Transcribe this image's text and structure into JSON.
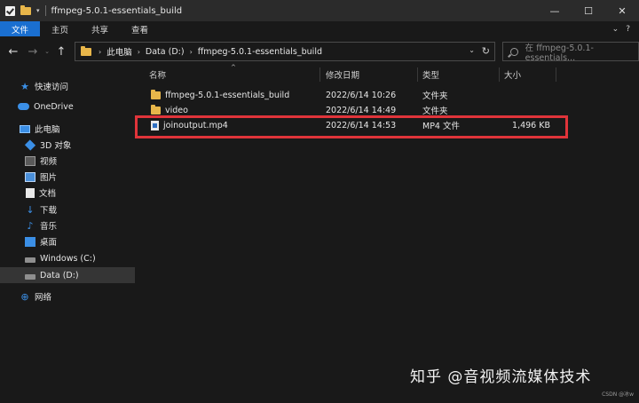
{
  "window": {
    "title": "ffmpeg-5.0.1-essentials_build",
    "controls": {
      "minimize": "—",
      "maximize": "☐",
      "close": "✕"
    }
  },
  "ribbon": {
    "tabs": [
      "文件",
      "主页",
      "共享",
      "查看"
    ],
    "expand_glyph": "⌄",
    "help_glyph": "?"
  },
  "address": {
    "crumbs": [
      "此电脑",
      "Data (D:)",
      "ffmpeg-5.0.1-essentials_build"
    ],
    "separator": "›"
  },
  "search": {
    "placeholder": "在 ffmpeg-5.0.1-essentials..."
  },
  "sidebar": {
    "items": [
      {
        "label": "快速访问",
        "icon": "star-icon"
      },
      {
        "label": "OneDrive",
        "icon": "cloud-icon"
      },
      {
        "label": "此电脑",
        "icon": "pc-icon"
      },
      {
        "label": "3D 对象",
        "icon": "cube-icon"
      },
      {
        "label": "视频",
        "icon": "video-icon"
      },
      {
        "label": "图片",
        "icon": "picture-icon"
      },
      {
        "label": "文档",
        "icon": "document-icon"
      },
      {
        "label": "下载",
        "icon": "download-icon"
      },
      {
        "label": "音乐",
        "icon": "music-icon"
      },
      {
        "label": "桌面",
        "icon": "desktop-icon"
      },
      {
        "label": "Windows (C:)",
        "icon": "drive-icon"
      },
      {
        "label": "Data (D:)",
        "icon": "drive-icon",
        "selected": true
      },
      {
        "label": "网络",
        "icon": "network-icon"
      }
    ]
  },
  "columns": {
    "name": "名称",
    "date": "修改日期",
    "type": "类型",
    "size": "大小"
  },
  "files": [
    {
      "name": "ffmpeg-5.0.1-essentials_build",
      "date": "2022/6/14 10:26",
      "type": "文件夹",
      "size": "",
      "icon": "folder-icon"
    },
    {
      "name": "video",
      "date": "2022/6/14 14:49",
      "type": "文件夹",
      "size": "",
      "icon": "folder-icon"
    },
    {
      "name": "joinoutput.mp4",
      "date": "2022/6/14 14:53",
      "type": "MP4 文件",
      "size": "1,496 KB",
      "icon": "video-file-icon"
    }
  ],
  "watermark": "知乎 @音视频流媒体技术",
  "csdn": "CSDN @冰w",
  "colors": {
    "accent": "#1a6fd0",
    "highlight_box": "#e0343a",
    "background": "#191919"
  }
}
